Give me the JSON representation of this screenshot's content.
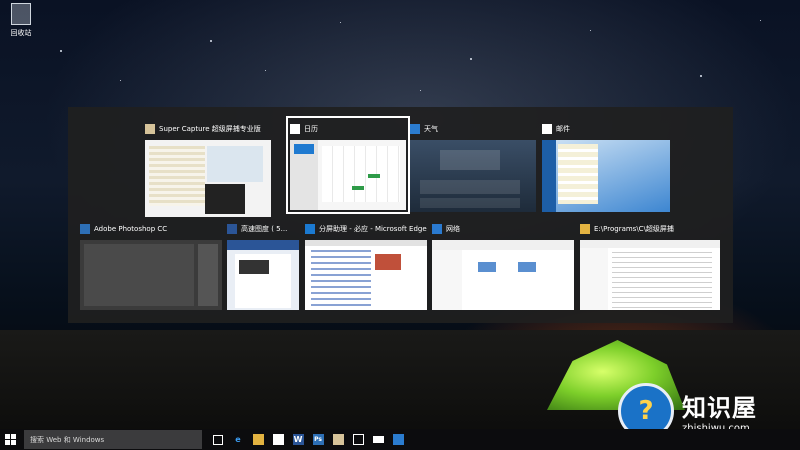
{
  "desktop": {
    "recycle_bin_label": "回收站"
  },
  "switcher": {
    "windows": [
      {
        "title": "Super Capture 超级屏捕专业版",
        "icon": "super-capture-icon",
        "accent": "#d6c39a"
      },
      {
        "title": "日历",
        "icon": "calendar-icon",
        "accent": "#1f7ad0",
        "selected": true
      },
      {
        "title": "天气",
        "icon": "weather-icon",
        "accent": "#2b7ccf"
      },
      {
        "title": "邮件",
        "icon": "mail-icon",
        "accent": "#0f64c0"
      },
      {
        "title": "Adobe Photoshop CC",
        "icon": "photoshop-icon",
        "accent": "#2d6fb6"
      },
      {
        "title": "高速图度 ( 5...",
        "icon": "word-icon",
        "accent": "#2b5597"
      },
      {
        "title": "分屏助理 - 必应 - Microsoft Edge",
        "icon": "edge-icon",
        "accent": "#1b7ad1"
      },
      {
        "title": "网络",
        "icon": "network-icon",
        "accent": "#2a7ad0"
      },
      {
        "title": "E:\\Programs\\C\\超级屏捕",
        "icon": "folder-icon",
        "accent": "#e3b341"
      }
    ]
  },
  "taskbar": {
    "search_placeholder": "搜索 Web 和 Windows",
    "icons": [
      "task-view-icon",
      "edge-icon",
      "file-explorer-icon",
      "store-icon",
      "word-icon",
      "photoshop-icon",
      "super-capture-icon",
      "calendar-icon",
      "mail-icon",
      "weather-icon"
    ],
    "icon_labels": {
      "word": "W",
      "photoshop": "Ps"
    }
  },
  "watermark": {
    "name": "知识屋",
    "url": "zhishiwu.com"
  }
}
